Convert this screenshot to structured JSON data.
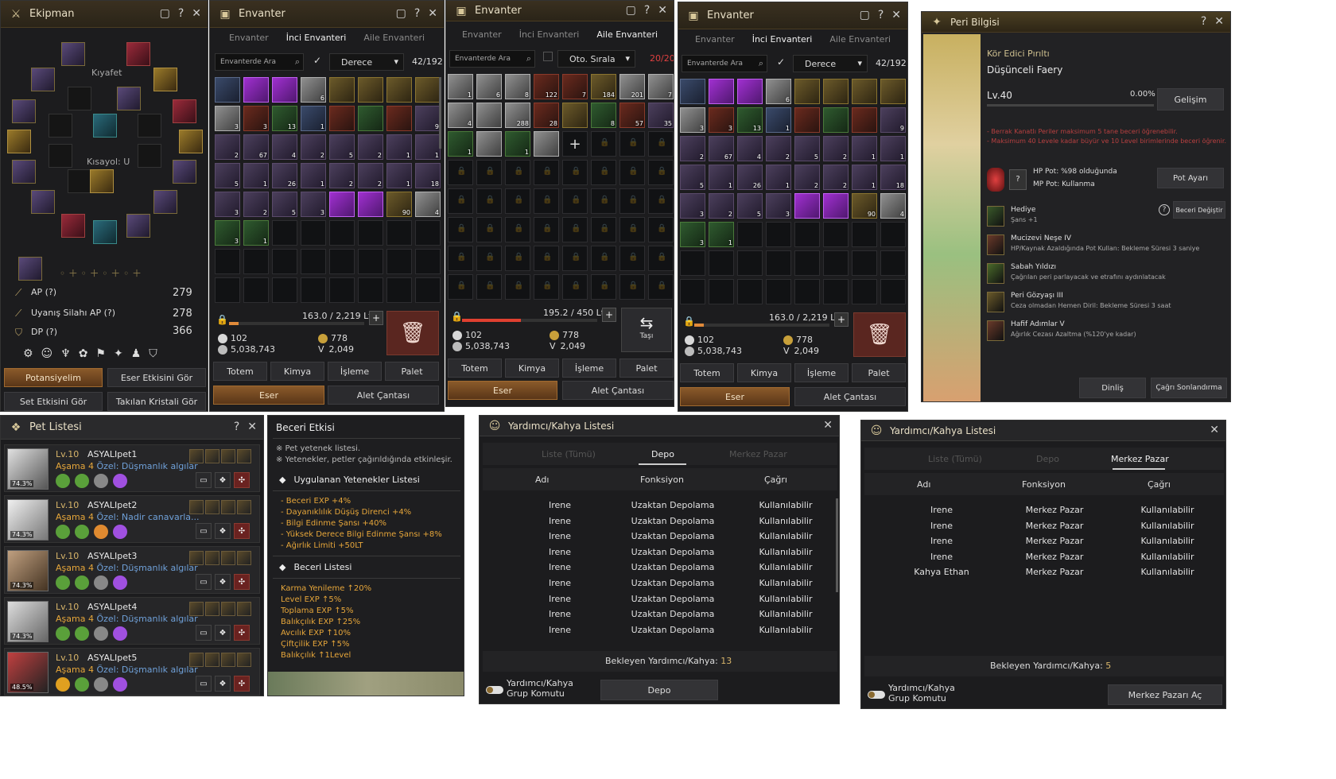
{
  "ekipman": {
    "title": "Ekipman",
    "kiyafet_label": "Kıyafet",
    "kisayol_label": "Kısayol: U",
    "stats": [
      {
        "label": "AP (?)",
        "value": "279"
      },
      {
        "label": "Uyanış Silahı AP (?)",
        "value": "278"
      },
      {
        "label": "DP (?)",
        "value": "366"
      }
    ],
    "buttons": {
      "potansiyelim": "Potansiyelim",
      "eser_etkisini_gor": "Eser Etkisini Gör",
      "set_etkisini_gor": "Set Etkisini Gör",
      "takilan_kristali_gor": "Takılan Kristali Gör"
    }
  },
  "envanter1": {
    "title": "Envanter",
    "tabs": [
      "Envanter",
      "İnci Envanteri",
      "Aile Envanteri"
    ],
    "active_tab": 1,
    "search_placeholder": "Envanterde Ara",
    "sort_label": "Derece",
    "capacity": "42/192",
    "weight": "163.0 / 2,219 Lt",
    "weight_fraction": 0.073,
    "silver_a": "102",
    "silver_b": "5,038,743",
    "currency_a": "778",
    "currency_b": "2,049",
    "buttons": [
      "Totem",
      "Kimya",
      "İşleme",
      "Palet"
    ],
    "bottom": [
      "Eser",
      "Alet Çantası"
    ],
    "row1": [
      [
        "c-blue",
        ""
      ],
      [
        "c-purple",
        ""
      ],
      [
        "c-purple",
        ""
      ],
      [
        "c-white",
        "6"
      ],
      [
        "c-gold",
        ""
      ],
      [
        "c-gold",
        ""
      ],
      [
        "c-gold",
        ""
      ],
      [
        "c-gold",
        ""
      ]
    ],
    "row2": [
      [
        "c-white",
        "3"
      ],
      [
        "c-red",
        "3"
      ],
      [
        "c-green",
        "13"
      ],
      [
        "c-blue",
        "1"
      ],
      [
        "c-red",
        ""
      ],
      [
        "c-green",
        ""
      ],
      [
        "c-red",
        ""
      ],
      [
        "item",
        "9"
      ]
    ],
    "row3": [
      [
        "item",
        "2"
      ],
      [
        "item",
        "67"
      ],
      [
        "item",
        "4"
      ],
      [
        "item",
        "2"
      ],
      [
        "item",
        "5"
      ],
      [
        "item",
        "2"
      ],
      [
        "item",
        "1"
      ],
      [
        "item",
        "1"
      ]
    ],
    "row4": [
      [
        "item",
        "5"
      ],
      [
        "item",
        "1"
      ],
      [
        "item",
        "26"
      ],
      [
        "item",
        "1"
      ],
      [
        "item",
        "2"
      ],
      [
        "item",
        "2"
      ],
      [
        "item",
        "1"
      ],
      [
        "item",
        "18"
      ]
    ],
    "row5": [
      [
        "item",
        "3"
      ],
      [
        "item",
        "2"
      ],
      [
        "item",
        "5"
      ],
      [
        "item",
        "3"
      ],
      [
        "c-purple",
        ""
      ],
      [
        "c-purple",
        ""
      ],
      [
        "c-gold",
        "90"
      ],
      [
        "c-white",
        "4"
      ]
    ],
    "row6": [
      [
        "c-green",
        "3"
      ],
      [
        "c-green",
        "1"
      ]
    ]
  },
  "envanter2": {
    "title": "Envanter",
    "tabs": [
      "Envanter",
      "İnci Envanteri",
      "Aile Envanteri"
    ],
    "active_tab": 2,
    "search_placeholder": "Envanterde Ara",
    "sort_label": "Oto. Sırala",
    "capacity": "20/20",
    "weight": "195.2 / 450 Lt",
    "weight_fraction": 0.434,
    "silver_a": "102",
    "silver_b": "5,038,743",
    "currency_a": "778",
    "currency_b": "2,049",
    "tasi_label": "Taşı",
    "buttons": [
      "Totem",
      "Kimya",
      "İşleme",
      "Palet"
    ],
    "bottom": [
      "Eser",
      "Alet Çantası"
    ],
    "row1": [
      [
        "c-white",
        "1"
      ],
      [
        "c-white",
        "6"
      ],
      [
        "c-white",
        "8"
      ],
      [
        "c-red",
        "122"
      ],
      [
        "c-red",
        "7"
      ],
      [
        "c-gold",
        "184"
      ],
      [
        "c-white",
        "201"
      ],
      [
        "c-white",
        "7"
      ]
    ],
    "row2": [
      [
        "c-white",
        "4"
      ],
      [
        "c-white",
        ""
      ],
      [
        "c-white",
        "288"
      ],
      [
        "c-red",
        "28"
      ],
      [
        "c-gold",
        ""
      ],
      [
        "c-green",
        "8"
      ],
      [
        "c-red",
        "57"
      ],
      [
        "item",
        "35"
      ]
    ],
    "row3": [
      [
        "c-green",
        "1"
      ],
      [
        "c-white",
        ""
      ],
      [
        "c-green",
        "1"
      ],
      [
        "c-white",
        ""
      ]
    ]
  },
  "envanter3": {
    "title": "Envanter",
    "tabs": [
      "Envanter",
      "İnci Envanteri",
      "Aile Envanteri"
    ],
    "active_tab": 1,
    "search_placeholder": "Envanterde Ara",
    "sort_label": "Derece",
    "capacity": "42/192",
    "weight": "163.0 / 2,219 Lt",
    "weight_fraction": 0.073,
    "silver_a": "102",
    "silver_b": "5,038,743",
    "currency_a": "778",
    "currency_b": "2,049",
    "buttons": [
      "Totem",
      "Kimya",
      "İşleme",
      "Palet"
    ],
    "bottom": [
      "Eser",
      "Alet Çantası"
    ]
  },
  "peri": {
    "title": "Peri Bilgisi",
    "line1": "Kör Edici Pırıltı",
    "line2": "Düşünceli Faery",
    "level": "Lv.40",
    "progress": "0.00%",
    "progress_fraction": 0.0,
    "gelisim": "Gelişim",
    "note1": "- Berrak Kanatlı Periler maksimum 5 tane beceri öğrenebilir.",
    "note2": "- Maksimum 40 Levele kadar büyür ve 10 Level birimlerinde beceri öğrenir.",
    "hp_pot": "HP Pot: %98 olduğunda",
    "mp_pot": "MP Pot: Kullanma",
    "pot_button": "Pot Ayarı",
    "q_mark": "?",
    "beceri_degistir": "Beceri Değiştir",
    "skills": [
      {
        "name": "Hediye",
        "desc": "Şans +1"
      },
      {
        "name": "Mucizevi Neşe IV",
        "desc": "HP/Kaynak Azaldığında Pot Kullan: Bekleme Süresi 3 saniye"
      },
      {
        "name": "Sabah Yıldızı",
        "desc": "Çağrılan peri parlayacak ve etrafını aydınlatacak"
      },
      {
        "name": "Peri Gözyaşı III",
        "desc": "Ceza olmadan Hemen Diril: Bekleme Süresi 3 saat"
      },
      {
        "name": "Hafif Adımlar V",
        "desc": "Ağırlık Cezası Azaltma (%120'ye kadar)"
      }
    ],
    "dinlis": "Dinliş",
    "cagri_sonlandirma": "Çağrı Sonlandırma"
  },
  "pets": {
    "title": "Pet Listesi",
    "rows": [
      {
        "lv": "Lv.10",
        "name": "ASYALIpet1",
        "stage": "Aşama 4",
        "desc": "Özel: Düşmanlık algılar",
        "pct": "74.3%"
      },
      {
        "lv": "Lv.10",
        "name": "ASYALIpet2",
        "stage": "Aşama 4",
        "desc": "Özel: Nadir canavarla...",
        "pct": "74.3%"
      },
      {
        "lv": "Lv.10",
        "name": "ASYALIpet3",
        "stage": "Aşama 4",
        "desc": "Özel: Düşmanlık algılar",
        "pct": "74.3%"
      },
      {
        "lv": "Lv.10",
        "name": "ASYALIpet4",
        "stage": "Aşama 4",
        "desc": "Özel: Düşmanlık algılar",
        "pct": "74.3%"
      },
      {
        "lv": "Lv.10",
        "name": "ASYALIpet5",
        "stage": "Aşama 4",
        "desc": "Özel: Düşmanlık algılar",
        "pct": "48.5%"
      }
    ]
  },
  "beceri": {
    "title": "Beceri Etkisi",
    "note1": "※ Pet yetenek listesi.",
    "note2": "※ Yetenekler, petler çağırıldığında etkinleşir.",
    "applied_title": "Uygulanan Yetenekler Listesi",
    "applied": [
      "- Beceri EXP +4%",
      "- Dayanıklılık Düşüş Direnci +4%",
      "- Bilgi Edinme Şansı +40%",
      "- Yüksek Derece Bilgi Edinme Şansı +8%",
      "- Ağırlık Limiti +50LT"
    ],
    "skill_title": "Beceri Listesi",
    "skills": [
      "Karma Yenileme ↑20%",
      "Level EXP ↑5%",
      "Toplama EXP ↑5%",
      "Balıkçılık EXP ↑25%",
      "Avcılık EXP ↑10%",
      "Çiftçilik EXP ↑5%",
      "Balıkçılık ↑1Level"
    ]
  },
  "yardimci1": {
    "title": "Yardımcı/Kahya Listesi",
    "tabs": [
      "Liste (Tümü)",
      "Depo",
      "Merkez Pazar"
    ],
    "active_tab": 1,
    "headers": [
      "Adı",
      "Fonksiyon",
      "Çağrı"
    ],
    "rows": [
      [
        "Irene",
        "Uzaktan Depolama",
        "Kullanılabilir"
      ],
      [
        "Irene",
        "Uzaktan Depolama",
        "Kullanılabilir"
      ],
      [
        "Irene",
        "Uzaktan Depolama",
        "Kullanılabilir"
      ],
      [
        "Irene",
        "Uzaktan Depolama",
        "Kullanılabilir"
      ],
      [
        "Irene",
        "Uzaktan Depolama",
        "Kullanılabilir"
      ],
      [
        "Irene",
        "Uzaktan Depolama",
        "Kullanılabilir"
      ],
      [
        "Irene",
        "Uzaktan Depolama",
        "Kullanılabilir"
      ],
      [
        "Irene",
        "Uzaktan Depolama",
        "Kullanılabilir"
      ],
      [
        "Irene",
        "Uzaktan Depolama",
        "Kullanılabilir"
      ]
    ],
    "waiting_label": "Bekleyen Yardımcı/Kahya:",
    "waiting_count": "13",
    "group_label": "Yardımcı/Kahya Grup Komutu",
    "action_button": "Depo"
  },
  "yardimci2": {
    "title": "Yardımcı/Kahya Listesi",
    "tabs": [
      "Liste (Tümü)",
      "Depo",
      "Merkez Pazar"
    ],
    "active_tab": 2,
    "headers": [
      "Adı",
      "Fonksiyon",
      "Çağrı"
    ],
    "rows": [
      [
        "Irene",
        "Merkez Pazar",
        "Kullanılabilir"
      ],
      [
        "Irene",
        "Merkez Pazar",
        "Kullanılabilir"
      ],
      [
        "Irene",
        "Merkez Pazar",
        "Kullanılabilir"
      ],
      [
        "Irene",
        "Merkez Pazar",
        "Kullanılabilir"
      ],
      [
        "Kahya Ethan",
        "Merkez Pazar",
        "Kullanılabilir"
      ]
    ],
    "waiting_label": "Bekleyen Yardımcı/Kahya:",
    "waiting_count": "5",
    "group_label": "Yardımcı/Kahya Grup Komutu",
    "action_button": "Merkez Pazarı Aç"
  }
}
